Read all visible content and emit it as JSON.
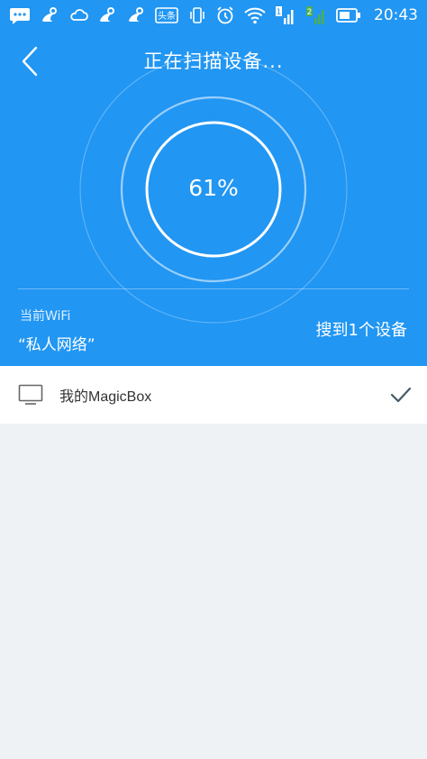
{
  "status_bar": {
    "time": "20:43",
    "toutiao_label": "头条",
    "sim1_label": "1",
    "sim2_label": "2",
    "icons": [
      "chat-bubble-icon",
      "uc-browser-icon",
      "weather-icon",
      "uc-browser-icon",
      "uc-browser-icon",
      "toutiao-icon",
      "vibrate-icon",
      "alarm-icon",
      "wifi-icon",
      "signal-icon",
      "signal-icon",
      "battery-icon"
    ]
  },
  "header": {
    "title": "正在扫描设备...",
    "progress_text": "61%",
    "wifi_label": "当前WiFi",
    "wifi_name": "“私人网络”",
    "found_text": "搜到1个设备"
  },
  "devices": [
    {
      "name": "我的MagicBox",
      "icon": "tv-icon",
      "checked": true
    }
  ],
  "colors": {
    "primary": "#2196f3",
    "background": "#eef2f4",
    "check": "#455a64"
  }
}
